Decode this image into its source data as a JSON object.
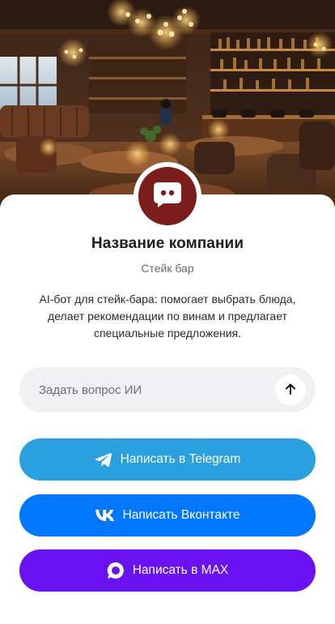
{
  "profile": {
    "company_name": "Название компании",
    "company_type": "Стейк бар",
    "description": "AI-бот для стейк-бара: помогает выбрать блюда, делает рекомендации по винам и предлагает специальные предложения.",
    "avatar_icon": "chat-bubble-icon",
    "avatar_color": "#7b1d1d"
  },
  "ask": {
    "placeholder": "Задать вопрос ИИ",
    "send_icon": "arrow-up-icon"
  },
  "buttons": [
    {
      "label": "Написать в Telegram",
      "icon": "telegram-icon",
      "color": "#2aa1de"
    },
    {
      "label": "Написать Вконтакте",
      "icon": "vk-icon",
      "color": "#0077ff"
    },
    {
      "label": "Написать в MAX",
      "icon": "max-icon",
      "color": "#6a11f2"
    }
  ]
}
